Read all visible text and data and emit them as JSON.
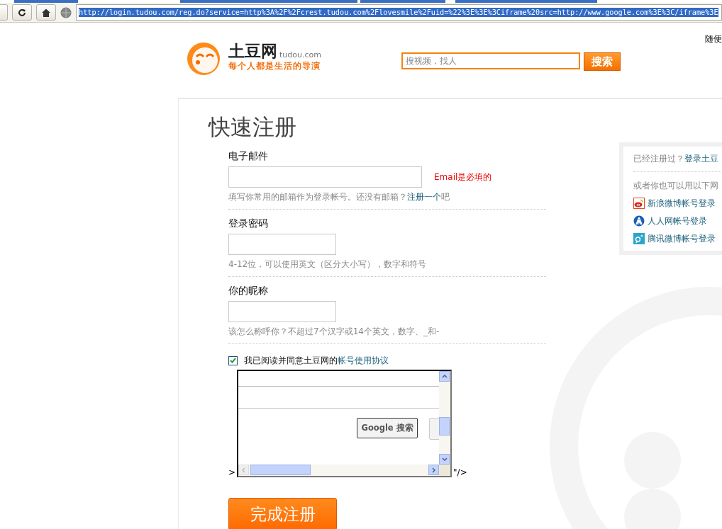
{
  "browser": {
    "url": "http://login.tudou.com/reg.do?service=http%3A%2F%2Fcrest.tudou.com%2Flovesmile%2Fuid=%22%3E%3E%3Ciframe%20src=http://www.google.com%3E%3C/iframe%3E",
    "url_selected": true
  },
  "top_link": "随便",
  "header": {
    "logo_title": "土豆网",
    "logo_domain": "tudou.com",
    "slogan": "每个人都是生活的导演",
    "search": {
      "placeholder": "搜视频，找人"
    },
    "search_button": "搜索"
  },
  "form": {
    "title": "快速注册",
    "fields": [
      {
        "kind": "email",
        "label": "电子邮件",
        "error": "Email是必填的",
        "hint": "填写你常用的邮箱作为登录帐号。还没有邮箱？",
        "hint_link": "注册一个",
        "hint_after": "吧"
      },
      {
        "kind": "password",
        "label": "登录密码",
        "hint": "4-12位，可以使用英文（区分大小写），数字和符号"
      },
      {
        "kind": "text",
        "label": "你的昵称",
        "hint": "该怎么称呼你？不超过7个汉字或14个英文，数字、_和-"
      }
    ]
  },
  "agreement": {
    "checked": true,
    "text": "我已阅读并同意土豆网的",
    "link": "帐号使用协议"
  },
  "embed": {
    "prefix": ">",
    "button": "Google 搜索",
    "suffix": "\"/>"
  },
  "submit": "完成注册",
  "login_box": {
    "prompt": "已经注册过？",
    "login_link": "登录土豆",
    "alt_text": "或者你也可以用以下网",
    "providers": [
      {
        "kind": "weibo",
        "label": "新浪微博帐号登录"
      },
      {
        "kind": "renren",
        "label": "人人网帐号登录"
      },
      {
        "kind": "tencent",
        "label": "腾讯微博帐号登录"
      }
    ]
  }
}
